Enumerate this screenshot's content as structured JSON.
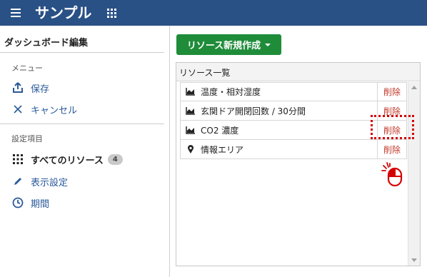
{
  "header": {
    "title": "サンプル",
    "menu_icon": "hamburger-icon",
    "apps_icon": "grid-icon",
    "background": "#2a5186"
  },
  "sidebar": {
    "title": "ダッシュボード編集",
    "menu_section": "メニュー",
    "menu_items": [
      {
        "label": "保存",
        "icon": "upload-icon"
      },
      {
        "label": "キャンセル",
        "icon": "close-icon"
      }
    ],
    "settings_section": "設定項目",
    "settings_items": [
      {
        "label": "すべてのリソース",
        "icon": "grid-icon",
        "badge": "4"
      },
      {
        "label": "表示設定",
        "icon": "pencil-icon"
      },
      {
        "label": "期間",
        "icon": "clock-icon"
      }
    ]
  },
  "main": {
    "new_button_label": "リソース新規作成",
    "panel_title": "リソース一覧",
    "delete_label": "削除",
    "resources": [
      {
        "name": "温度・相対湿度",
        "icon": "area-chart-icon"
      },
      {
        "name": "玄関ドア開閉回数 / 30分間",
        "icon": "area-chart-icon"
      },
      {
        "name": "CO2 濃度",
        "icon": "area-chart-icon"
      },
      {
        "name": "情報エリア",
        "icon": "map-pin-icon"
      }
    ]
  },
  "colors": {
    "accent_green": "#1f8c3a",
    "link_blue": "#2a5a9a",
    "delete_red": "#c0392b",
    "highlight_red": "#d40000"
  }
}
